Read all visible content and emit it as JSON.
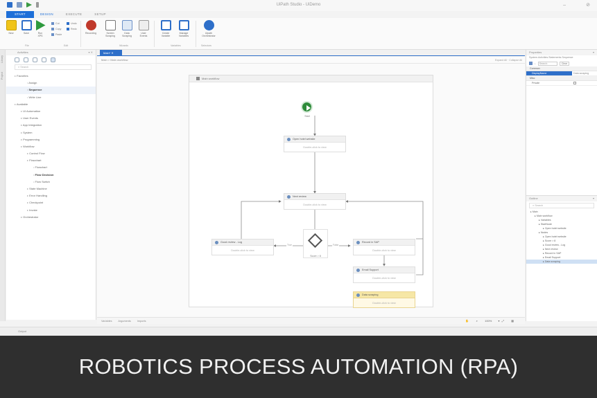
{
  "window": {
    "title": "UiPath Studio - UiDemo"
  },
  "ribbon": {
    "tabs": [
      "START",
      "DESIGN",
      "EXECUTE",
      "SETUP"
    ],
    "active_tab": "DESIGN",
    "buttons": {
      "new": "New",
      "save": "Save",
      "run": "Run\nXPS",
      "recording": "Recording",
      "screen_scraping": "Screen\nScraping",
      "data_scraping": "Data\nScraping",
      "user_events": "User\nEvents",
      "create_variable": "Create\nVariable",
      "manage_variables": "Manage\nVariables",
      "uipath_orchestrator": "Uipath\nOrchestrator"
    },
    "small_buttons": {
      "cut": "Cut",
      "copy": "Copy",
      "paste": "Paste",
      "undo": "Undo",
      "redo": "Redo"
    },
    "groups": {
      "file": "File",
      "edit": "Edit",
      "wizards": "Wizards",
      "variables": "Variables",
      "selectors": "Selectors"
    }
  },
  "left_rail": {
    "library": "Library",
    "project": "Project"
  },
  "activities": {
    "title": "Activities",
    "search_placeholder": "Search",
    "tree": [
      {
        "label": "Favorites",
        "indent": 0,
        "style": ""
      },
      {
        "label": "Assign",
        "indent": 2,
        "style": ""
      },
      {
        "label": "Sequence",
        "indent": 2,
        "style": "bold sel"
      },
      {
        "label": "Write Line",
        "indent": 2,
        "style": ""
      },
      {
        "label": "Available",
        "indent": 0,
        "style": ""
      },
      {
        "label": "UI Automation",
        "indent": 1,
        "style": ""
      },
      {
        "label": "User Events",
        "indent": 1,
        "style": ""
      },
      {
        "label": "App Integration",
        "indent": 1,
        "style": ""
      },
      {
        "label": "System",
        "indent": 1,
        "style": ""
      },
      {
        "label": "Programming",
        "indent": 1,
        "style": ""
      },
      {
        "label": "Workflow",
        "indent": 1,
        "style": ""
      },
      {
        "label": "Control Flow",
        "indent": 2,
        "style": ""
      },
      {
        "label": "Flowchart",
        "indent": 2,
        "style": ""
      },
      {
        "label": "Flowchart",
        "indent": 3,
        "style": ""
      },
      {
        "label": "Flow Decision",
        "indent": 3,
        "style": "bold"
      },
      {
        "label": "Flow Switch",
        "indent": 3,
        "style": ""
      },
      {
        "label": "State Machine",
        "indent": 2,
        "style": ""
      },
      {
        "label": "Error Handling",
        "indent": 2,
        "style": ""
      },
      {
        "label": "Checkpoint",
        "indent": 2,
        "style": ""
      },
      {
        "label": "Invoke",
        "indent": 2,
        "style": ""
      },
      {
        "label": "Orchestrator",
        "indent": 1,
        "style": ""
      }
    ]
  },
  "designer": {
    "doc_tab": "Main*",
    "breadcrumb": "Main  >  Main workflow",
    "expand_all": "Expand All",
    "collapse_all": "Collapse All",
    "flowchart_title": "Main workflow",
    "start_label": "Start",
    "decision_label": "Score > 8",
    "true_label": "True",
    "false_label": "False",
    "nodes": {
      "open_hotel": {
        "title": "Open hotel website",
        "body": "Double-click to view"
      },
      "next_review": {
        "title": "Next review",
        "body": "Double-click to view"
      },
      "good_review": {
        "title": "Good review - Log",
        "body": "Double-click to view"
      },
      "record_sap": {
        "title": "Record in SAP",
        "body": "Double-click to view"
      },
      "email_support": {
        "title": "Email Support",
        "body": "Double-click to view"
      },
      "data_scraping": {
        "title": "Data scraping",
        "body": "Double-click to view"
      }
    },
    "footer_tabs": [
      "Variables",
      "Arguments",
      "Imports"
    ],
    "zoom": "100%"
  },
  "properties": {
    "title": "Properties",
    "subtitle": "System.Activities.Statements.Sequence",
    "search_placeholder": "Search:",
    "clear": "Clear",
    "sections": [
      "Common",
      "Misc"
    ],
    "rows": [
      {
        "key": "DisplayName",
        "value": "Data scraping",
        "section": "Common"
      },
      {
        "key": "Private",
        "value": "",
        "section": "Misc"
      }
    ]
  },
  "outline": {
    "title": "Outline",
    "search_placeholder": "Search",
    "items": [
      {
        "label": "Main",
        "indent": 0
      },
      {
        "label": "Main workflow",
        "indent": 1
      },
      {
        "label": "Variables",
        "indent": 2
      },
      {
        "label": "StartNode",
        "indent": 2
      },
      {
        "label": "Open hotel website",
        "indent": 3
      },
      {
        "label": "Nodes",
        "indent": 2
      },
      {
        "label": "Open hotel website",
        "indent": 3
      },
      {
        "label": "Score > 8",
        "indent": 3
      },
      {
        "label": "Good review - Log",
        "indent": 3
      },
      {
        "label": "Next review",
        "indent": 3
      },
      {
        "label": "Record in SAP",
        "indent": 3
      },
      {
        "label": "Email Support",
        "indent": 3
      },
      {
        "label": "Data scraping",
        "indent": 3
      }
    ]
  },
  "output": {
    "label": "Output"
  },
  "caption": "ROBOTICS PROCESS AUTOMATION (RPA)",
  "colors": {
    "accent": "#1e6fd8",
    "start_node": "#2e8b3a",
    "caption_bg": "#2f2f2f",
    "caption_text": "#f2f2f2",
    "highlight_node": "#f6e7a6"
  }
}
